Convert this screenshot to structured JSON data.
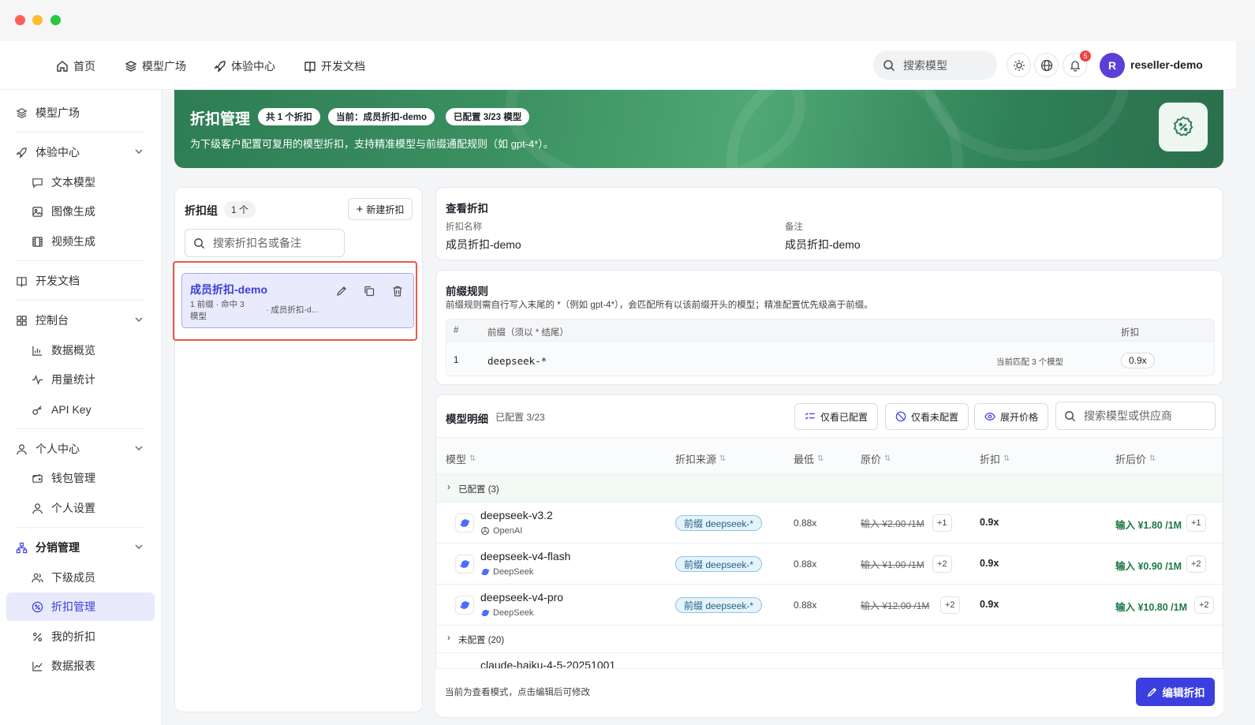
{
  "window": {
    "colors": {
      "close": "#fe5f57",
      "minimize": "#febc2e",
      "zoom": "#28c840"
    }
  },
  "topnav": {
    "items": [
      {
        "label": "首页",
        "icon": "home-icon"
      },
      {
        "label": "模型广场",
        "icon": "layers-icon"
      },
      {
        "label": "体验中心",
        "icon": "rocket-icon"
      },
      {
        "label": "开发文档",
        "icon": "book-icon"
      }
    ],
    "search_placeholder": "搜索模型",
    "notification_count": "5",
    "avatar_letter": "R",
    "username": "reseller-demo"
  },
  "sidebar": {
    "items": [
      {
        "label": "模型广场"
      },
      {
        "label": "体验中心"
      },
      {
        "label": "文本模型"
      },
      {
        "label": "图像生成"
      },
      {
        "label": "视频生成"
      },
      {
        "label": "开发文档"
      },
      {
        "label": "控制台"
      },
      {
        "label": "数据概览"
      },
      {
        "label": "用量统计"
      },
      {
        "label": "API Key"
      },
      {
        "label": "个人中心"
      },
      {
        "label": "钱包管理"
      },
      {
        "label": "个人设置"
      },
      {
        "label": "分销管理"
      },
      {
        "label": "下级成员"
      },
      {
        "label": "折扣管理"
      },
      {
        "label": "我的折扣"
      },
      {
        "label": "数据报表"
      }
    ],
    "active": "折扣管理"
  },
  "banner": {
    "title": "折扣管理",
    "pills": [
      "共 1 个折扣",
      "当前：成员折扣-demo",
      "已配置 3/23 模型"
    ],
    "subtitle": "为下级客户配置可复用的模型折扣，支持精准模型与前缀通配规则（如 gpt-4*）。",
    "color": "#3a8f60"
  },
  "discount_groups": {
    "title": "折扣组",
    "count": "1 个",
    "new_button": "新建折扣",
    "search_placeholder": "搜索折扣名或备注",
    "items": [
      {
        "name": "成员折扣-demo",
        "meta_line1": "1 前缀 · 命中 3",
        "meta_line2": "模型",
        "note": "· 成员折扣-d..."
      }
    ]
  },
  "view": {
    "title": "查看折扣",
    "name_label": "折扣名称",
    "name_value": "成员折扣-demo",
    "note_label": "备注",
    "note_value": "成员折扣-demo"
  },
  "prefix_rules": {
    "title": "前缀规则",
    "description": "前缀规则需自行写入末尾的 *（例如 gpt-4*），会匹配所有以该前缀开头的模型；精准配置优先级高于前缀。",
    "headers": [
      "#",
      "前缀（须以 * 结尾）",
      "折扣"
    ],
    "rows": [
      {
        "index": "1",
        "prefix": "deepseek-*",
        "match": "当前匹配 3 个模型",
        "discount": "0.9x"
      }
    ]
  },
  "model_detail": {
    "title": "模型明细",
    "subtitle": "已配置 3/23",
    "filters": [
      "仅看已配置",
      "仅看未配置",
      "展开价格"
    ],
    "search_placeholder": "搜索模型或供应商",
    "headers": [
      "模型",
      "折扣来源",
      "最低",
      "原价",
      "折扣",
      "折后价"
    ],
    "sort_glyph": "⇅",
    "configured_group": "已配置 (3)",
    "unconfigured_group": "未配置 (20)",
    "rows": [
      {
        "name": "deepseek-v3.2",
        "provider": "OpenAI",
        "source": "前缀 deepseek-*",
        "min": "0.88x",
        "orig": "输入 ¥2.00 /1M",
        "orig_more": "+1",
        "discount": "0.9x",
        "final": "输入 ¥1.80 /1M",
        "final_more": "+1"
      },
      {
        "name": "deepseek-v4-flash",
        "provider": "DeepSeek",
        "source": "前缀 deepseek-*",
        "min": "0.88x",
        "orig": "输入 ¥1.00 /1M",
        "orig_more": "+2",
        "discount": "0.9x",
        "final": "输入 ¥0.90 /1M",
        "final_more": "+2"
      },
      {
        "name": "deepseek-v4-pro",
        "provider": "DeepSeek",
        "source": "前缀 deepseek-*",
        "min": "0.88x",
        "orig": "输入 ¥12.00 /1M",
        "orig_more": "+2",
        "discount": "0.9x",
        "final": "输入 ¥10.80 /1M",
        "final_more": "+2"
      }
    ],
    "partial_row": "claude-haiku-4-5-20251001"
  },
  "footer": {
    "hint": "当前为查看模式，点击编辑后可修改",
    "edit_button": "编辑折扣",
    "accent": "#3b3fe0"
  }
}
